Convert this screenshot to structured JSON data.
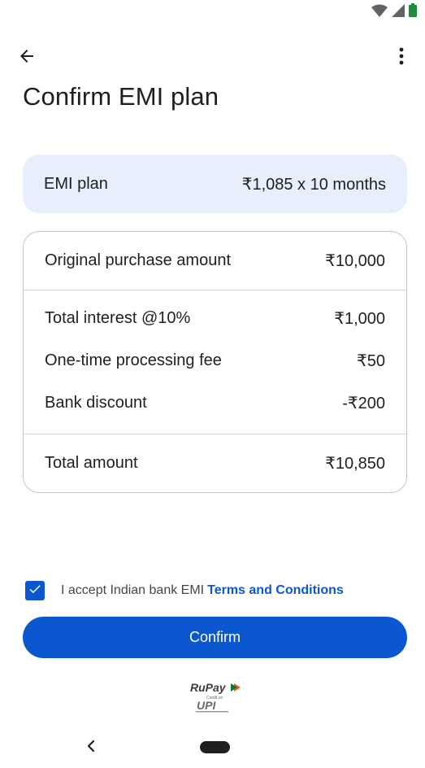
{
  "status_bar": {
    "icons": [
      "wifi-icon",
      "cellular-signal-icon",
      "battery-icon"
    ],
    "battery_color": "#1e8e3e"
  },
  "app_bar": {
    "back_icon": "arrow-back-icon",
    "menu_icon": "more-vert-icon"
  },
  "page": {
    "title": "Confirm EMI plan"
  },
  "emi_plan": {
    "label": "EMI plan",
    "value": "₹1,085 x 10 months"
  },
  "breakdown": {
    "original": {
      "label": "Original purchase amount",
      "value": "₹10,000"
    },
    "items": [
      {
        "label": "Total interest @10%",
        "value": "₹1,000"
      },
      {
        "label": "One-time processing fee",
        "value": "₹50"
      },
      {
        "label": "Bank discount",
        "value": "-₹200"
      }
    ],
    "total": {
      "label": "Total amount",
      "value": "₹10,850"
    }
  },
  "terms": {
    "checked": true,
    "text": "I accept Indian bank EMI",
    "link": "Terms and Conditions"
  },
  "confirm": {
    "label": "Confirm"
  },
  "footer_logo": {
    "brand": "RuPay",
    "sub": "Credit on",
    "upi": "UPI"
  },
  "colors": {
    "accent": "#0b57d0",
    "plan_background": "#e8effc",
    "border": "#c4c7c5",
    "text": "#1f1f1f"
  }
}
